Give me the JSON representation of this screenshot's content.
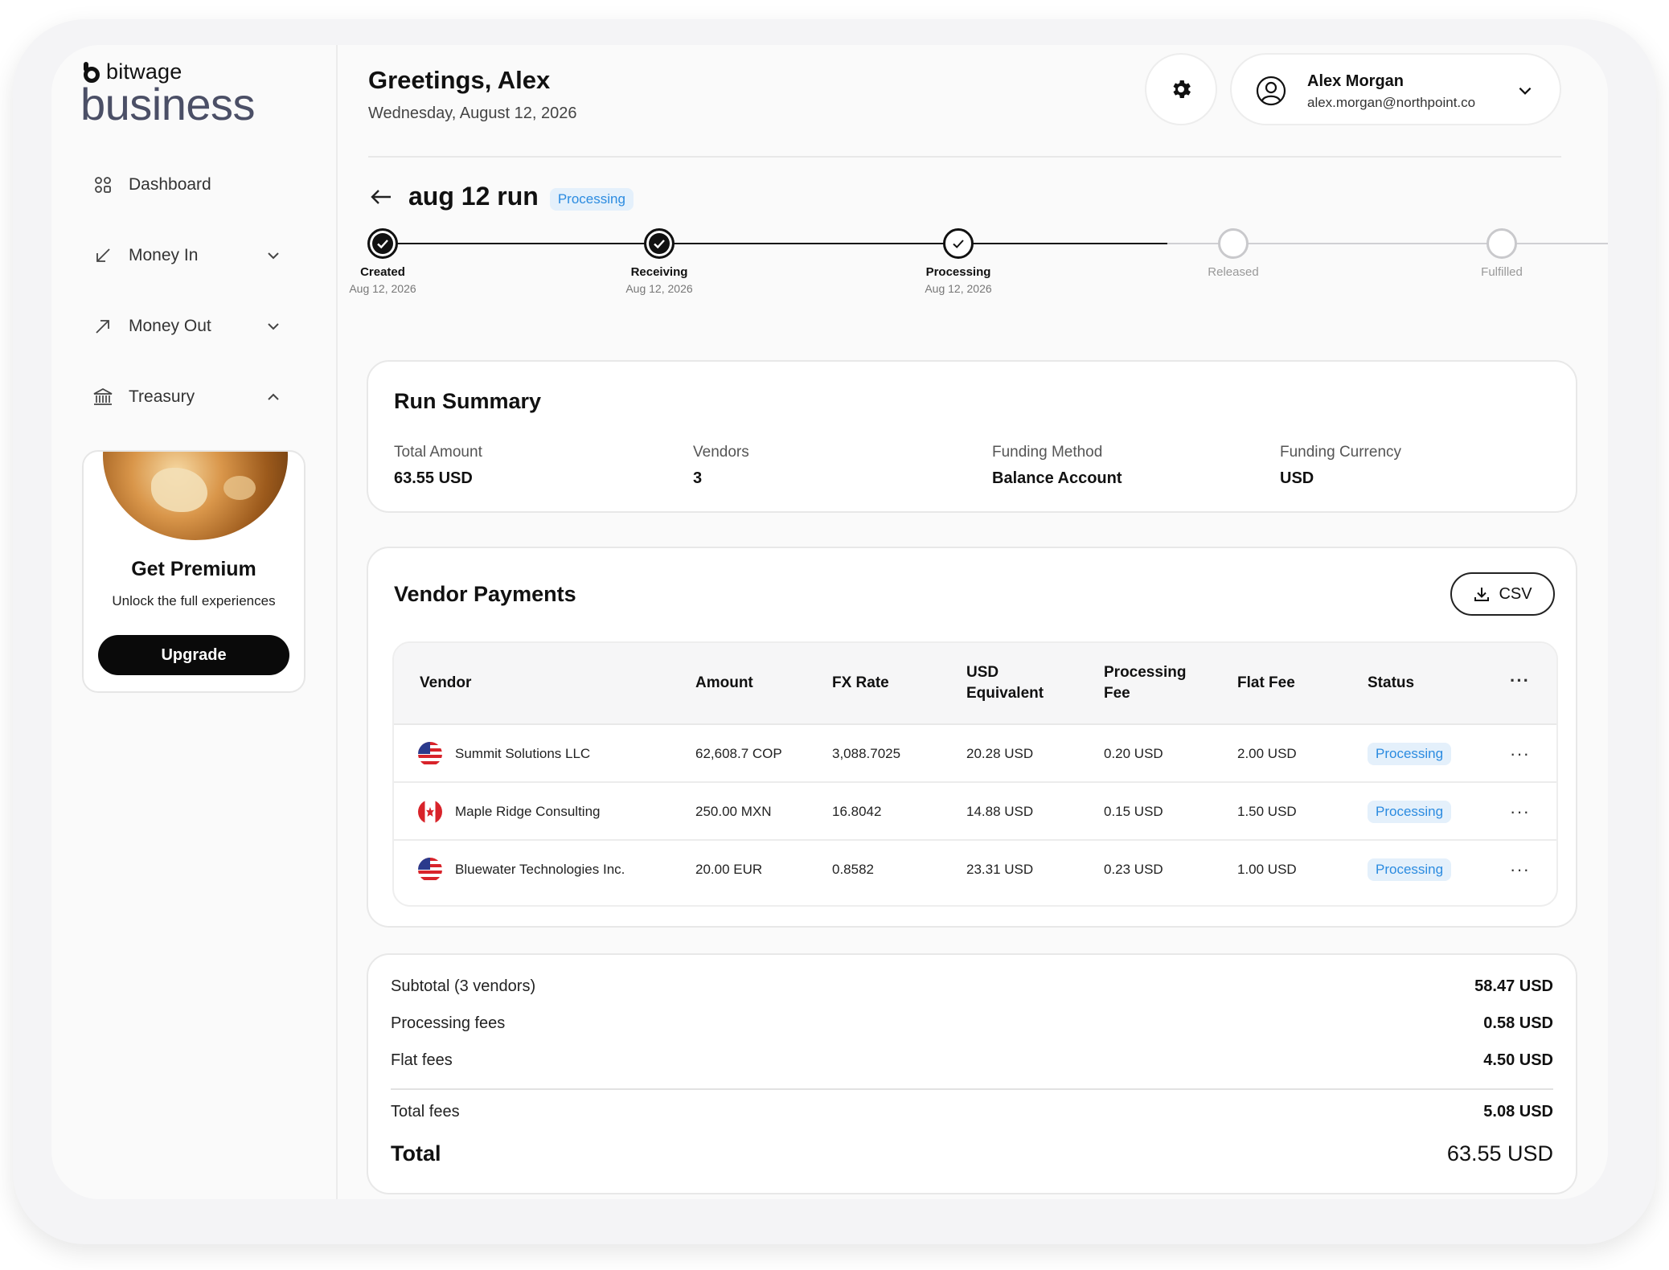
{
  "brand": {
    "top": "bitwage",
    "big": "business"
  },
  "sidebar": {
    "items": [
      {
        "label": "Dashboard"
      },
      {
        "label": "Money In"
      },
      {
        "label": "Money Out"
      },
      {
        "label": "Treasury"
      }
    ],
    "premium": {
      "title": "Get Premium",
      "subtitle": "Unlock the full experiences",
      "button": "Upgrade"
    }
  },
  "header": {
    "greeting": "Greetings, Alex",
    "date": "Wednesday, August 12, 2026",
    "user": {
      "name": "Alex Morgan",
      "email": "alex.morgan@northpoint.co"
    }
  },
  "run": {
    "title": "aug 12 run",
    "status": "Processing",
    "steps": [
      {
        "label": "Created",
        "date": "Aug 12, 2026",
        "state": "done"
      },
      {
        "label": "Receiving",
        "date": "Aug 12, 2026",
        "state": "done"
      },
      {
        "label": "Processing",
        "date": "Aug 12, 2026",
        "state": "current"
      },
      {
        "label": "Released",
        "date": "",
        "state": "pending"
      },
      {
        "label": "Fulfilled",
        "date": "",
        "state": "pending"
      }
    ]
  },
  "summary": {
    "title": "Run Summary",
    "fields": [
      {
        "label": "Total Amount",
        "value": "63.55 USD"
      },
      {
        "label": "Vendors",
        "value": "3"
      },
      {
        "label": "Funding Method",
        "value": "Balance Account"
      },
      {
        "label": "Funding Currency",
        "value": "USD"
      }
    ]
  },
  "vendors": {
    "title": "Vendor Payments",
    "csv_label": "CSV",
    "columns": {
      "vendor": "Vendor",
      "amount": "Amount",
      "fx": "FX Rate",
      "usd_1": "USD",
      "usd_2": "Equivalent",
      "proc_1": "Processing",
      "proc_2": "Fee",
      "flat": "Flat Fee",
      "status": "Status",
      "menu": "···"
    },
    "rows": [
      {
        "flag": "us-flag-icon",
        "vendor": "Summit Solutions LLC",
        "amount": "62,608.7 COP",
        "fx": "3,088.7025",
        "usd": "20.28 USD",
        "proc": "0.20 USD",
        "flat": "2.00 USD",
        "status": "Processing",
        "menu": "···"
      },
      {
        "flag": "canada-flag-icon",
        "vendor": "Maple Ridge Consulting",
        "amount": "250.00 MXN",
        "fx": "16.8042",
        "usd": "14.88 USD",
        "proc": "0.15 USD",
        "flat": "1.50 USD",
        "status": "Processing",
        "menu": "···"
      },
      {
        "flag": "us-flag-icon",
        "vendor": "Bluewater Technologies Inc.",
        "amount": "20.00 EUR",
        "fx": "0.8582",
        "usd": "23.31 USD",
        "proc": "0.23 USD",
        "flat": "1.00 USD",
        "status": "Processing",
        "menu": "···"
      }
    ]
  },
  "totals": {
    "subtotal_label": "Subtotal (3 vendors)",
    "subtotal": "58.47 USD",
    "proc_label": "Processing fees",
    "proc": "0.58 USD",
    "flat_label": "Flat fees",
    "flat": "4.50 USD",
    "fees_label": "Total fees",
    "fees": "5.08 USD",
    "total_label": "Total",
    "total": "63.55 USD"
  },
  "colors": {
    "accent_badge_bg": "#e4f0fb",
    "accent_badge_text": "#2b8be0",
    "brand_gray": "#4b4f66"
  }
}
